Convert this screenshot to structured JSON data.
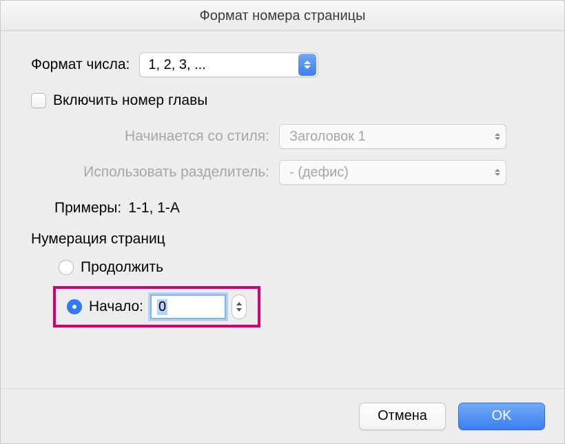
{
  "title": "Формат номера страницы",
  "number_format": {
    "label": "Формат числа:",
    "value": "1, 2, 3, ..."
  },
  "include_chapter": {
    "label": "Включить номер главы",
    "checked": false
  },
  "starts_with_style": {
    "label": "Начинается со стиля:",
    "value": "Заголовок 1"
  },
  "use_separator": {
    "label": "Использовать разделитель:",
    "value": "-    (дефис)"
  },
  "examples": {
    "label": "Примеры:",
    "value": "1-1, 1-A"
  },
  "pagination": {
    "section_label": "Нумерация страниц",
    "continue_label": "Продолжить",
    "start_label": "Начало:",
    "start_value": "0",
    "selected": "start"
  },
  "buttons": {
    "cancel": "Отмена",
    "ok": "OK"
  }
}
